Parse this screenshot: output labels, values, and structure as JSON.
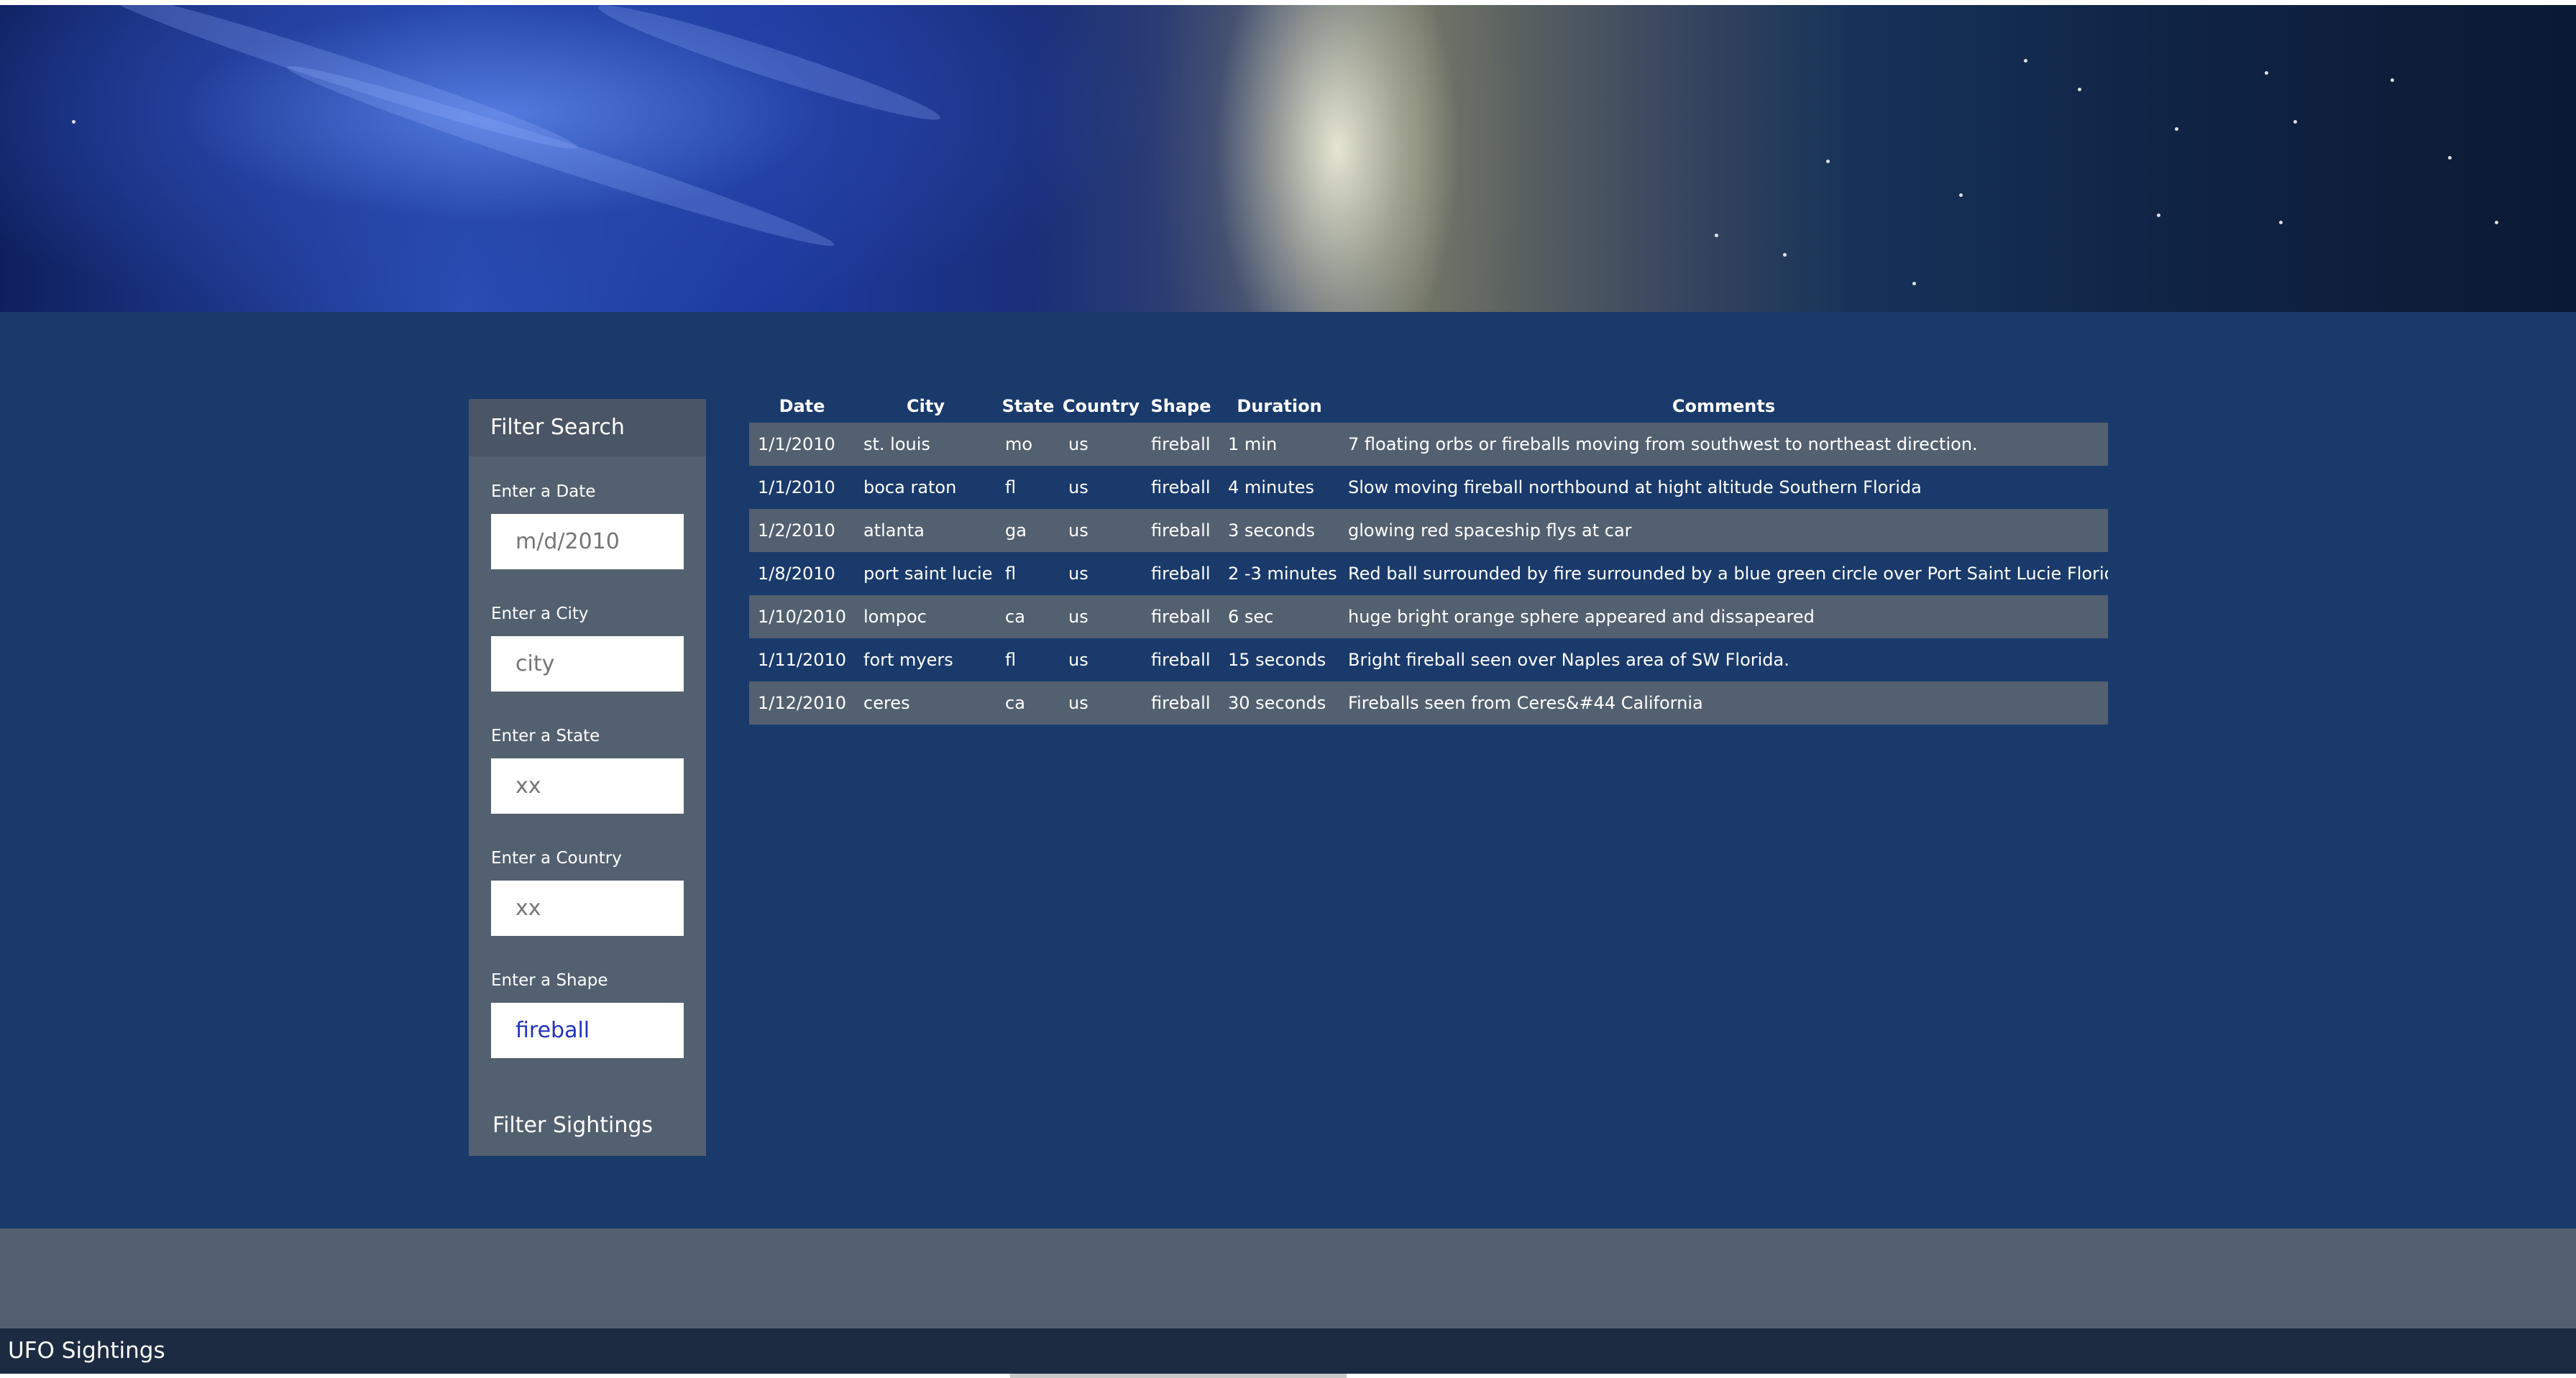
{
  "page": {
    "title": "UFO Sightings"
  },
  "banner": {
    "image": "ufo-light-beam-night-sky"
  },
  "sidebar": {
    "title": "Filter Search",
    "filters": [
      {
        "label": "Enter a Date",
        "placeholder": "m/d/2010",
        "value": ""
      },
      {
        "label": "Enter a City",
        "placeholder": "city",
        "value": ""
      },
      {
        "label": "Enter a State",
        "placeholder": "xx",
        "value": ""
      },
      {
        "label": "Enter a Country",
        "placeholder": "xx",
        "value": ""
      },
      {
        "label": "Enter a Shape",
        "placeholder": "",
        "value": "fireball"
      }
    ],
    "button_label": "Filter Sightings"
  },
  "table": {
    "columns": [
      "Date",
      "City",
      "State",
      "Country",
      "Shape",
      "Duration",
      "Comments"
    ],
    "rows": [
      [
        "1/1/2010",
        "st. louis",
        "mo",
        "us",
        "fireball",
        "1 min",
        "7 floating orbs or fireballs moving from southwest to northeast direction."
      ],
      [
        "1/1/2010",
        "boca raton",
        "fl",
        "us",
        "fireball",
        "4 minutes",
        "Slow moving fireball northbound at hight altitude Southern Florida"
      ],
      [
        "1/2/2010",
        "atlanta",
        "ga",
        "us",
        "fireball",
        "3 seconds",
        "glowing red spaceship flys at car"
      ],
      [
        "1/8/2010",
        "port saint lucie",
        "fl",
        "us",
        "fireball",
        "2 -3 minutes",
        "Red ball surrounded by fire surrounded by a blue green circle over Port Saint Lucie Florida"
      ],
      [
        "1/10/2010",
        "lompoc",
        "ca",
        "us",
        "fireball",
        "6 sec",
        "huge bright orange sphere appeared and dissapeared"
      ],
      [
        "1/11/2010",
        "fort myers",
        "fl",
        "us",
        "fireball",
        "15 seconds",
        "Bright fireball seen over Naples area of SW Florida."
      ],
      [
        "1/12/2010",
        "ceres",
        "ca",
        "us",
        "fireball",
        "30 seconds",
        "Fireballs seen from Ceres&#44 California"
      ]
    ]
  },
  "footer": {
    "title": "UFO Sightings"
  },
  "colors": {
    "background": "#1a3a6b",
    "panel": "#536070",
    "footer": "#1d2b42",
    "input_text": "#2233bb"
  }
}
